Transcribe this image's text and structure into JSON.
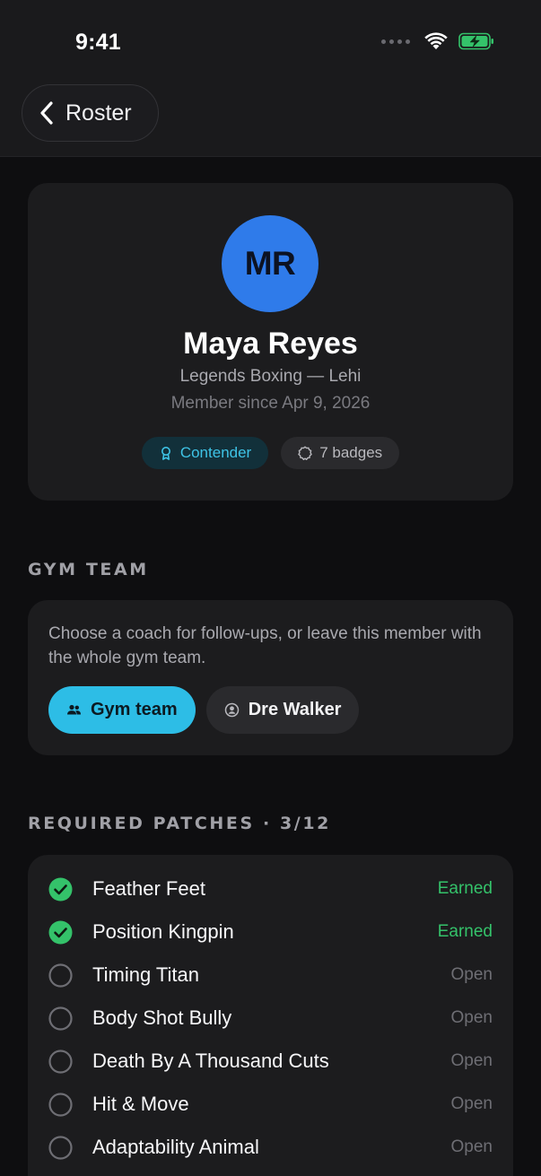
{
  "status_bar": {
    "time": "9:41"
  },
  "nav": {
    "back_label": "Roster"
  },
  "profile": {
    "initials": "MR",
    "name": "Maya Reyes",
    "gym": "Legends Boxing — Lehi",
    "member_since": "Member since Apr 9, 2026",
    "rank": "Contender",
    "badge_count": "7 badges"
  },
  "gym_team": {
    "title": "GYM TEAM",
    "description": "Choose a coach for follow-ups, or leave this member with the whole gym team.",
    "options": [
      {
        "label": "Gym team",
        "selected": true
      },
      {
        "label": "Dre Walker",
        "selected": false
      }
    ]
  },
  "patches": {
    "title": "REQUIRED PATCHES · 3/12",
    "items": [
      {
        "name": "Feather Feet",
        "status": "Earned"
      },
      {
        "name": "Position Kingpin",
        "status": "Earned"
      },
      {
        "name": "Timing Titan",
        "status": "Open"
      },
      {
        "name": "Body Shot Bully",
        "status": "Open"
      },
      {
        "name": "Death By A Thousand Cuts",
        "status": "Open"
      },
      {
        "name": "Hit & Move",
        "status": "Open"
      },
      {
        "name": "Adaptability Animal",
        "status": "Open"
      }
    ]
  },
  "colors": {
    "accent": "#2dbde6",
    "avatar": "#2f7bea",
    "earned": "#34c26a",
    "rank_text": "#3ec3e6"
  }
}
